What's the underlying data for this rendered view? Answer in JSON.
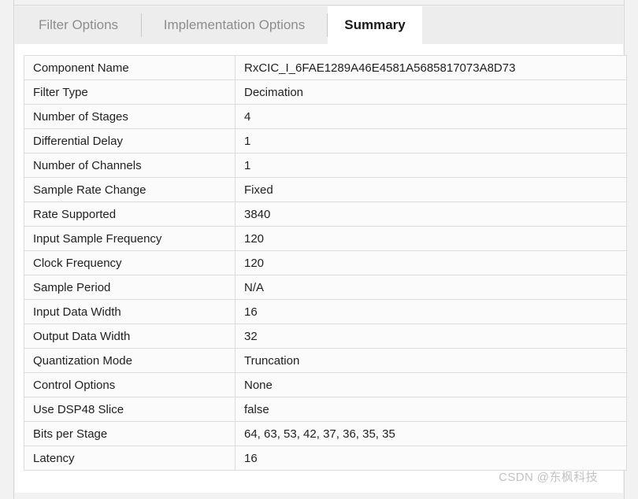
{
  "tabs": [
    {
      "label": "Filter Options",
      "active": false
    },
    {
      "label": "Implementation Options",
      "active": false
    },
    {
      "label": "Summary",
      "active": true
    }
  ],
  "summary_table": {
    "rows": [
      {
        "label": "Component Name",
        "value": "RxCIC_I_6FAE1289A46E4581A5685817073A8D73"
      },
      {
        "label": "Filter Type",
        "value": "Decimation"
      },
      {
        "label": "Number of Stages",
        "value": "4"
      },
      {
        "label": "Differential Delay",
        "value": "1"
      },
      {
        "label": "Number of Channels",
        "value": "1"
      },
      {
        "label": "Sample Rate Change",
        "value": "Fixed"
      },
      {
        "label": "Rate Supported",
        "value": "3840"
      },
      {
        "label": "Input Sample Frequency",
        "value": "120"
      },
      {
        "label": "Clock Frequency",
        "value": "120"
      },
      {
        "label": "Sample Period",
        "value": "N/A"
      },
      {
        "label": "Input Data Width",
        "value": "16"
      },
      {
        "label": "Output Data Width",
        "value": "32"
      },
      {
        "label": "Quantization Mode",
        "value": "Truncation"
      },
      {
        "label": "Control Options",
        "value": "None"
      },
      {
        "label": "Use DSP48 Slice",
        "value": "false"
      },
      {
        "label": "Bits per Stage",
        "value": "64, 63, 53, 42, 37, 36, 35, 35"
      },
      {
        "label": "Latency",
        "value": "16"
      }
    ]
  },
  "watermark": {
    "text": "CSDN @东枫科技"
  },
  "colors": {
    "tab_inactive_text": "#8d8d8d",
    "tab_active_text": "#1a1a1a",
    "tab_strip_bg": "#ededed",
    "pane_bg": "#ffffff",
    "table_cell_bg": "#fbfbfb",
    "table_border": "#dcdcdc",
    "watermark_text": "#c2c2c2"
  }
}
